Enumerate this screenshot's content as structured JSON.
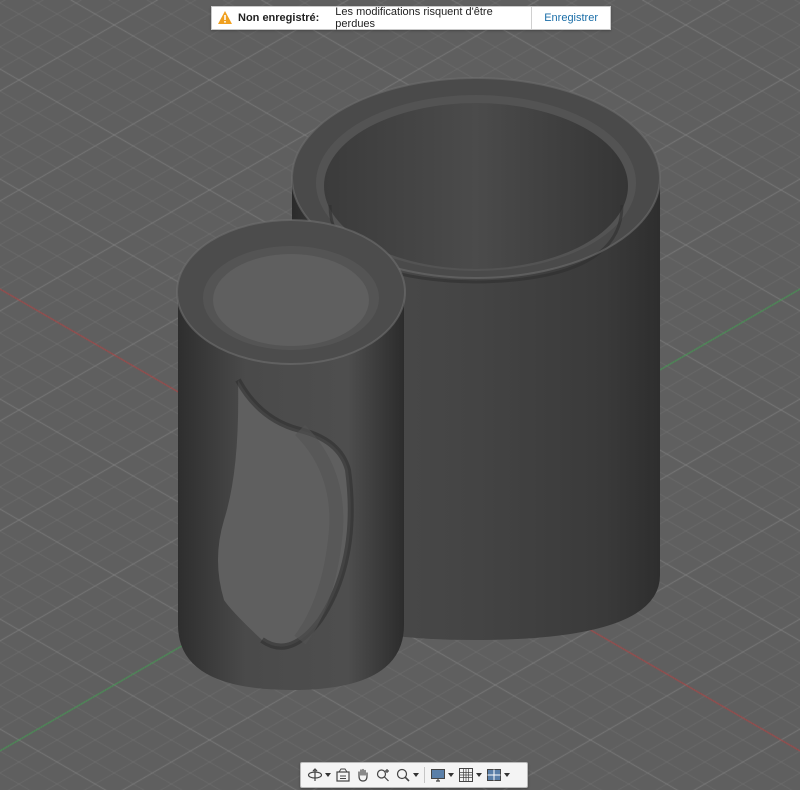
{
  "banner": {
    "title": "Non enregistré:",
    "message": "Les modifications risquent d'être perdues",
    "action": "Enregistrer",
    "warning_icon": "warning-triangle-icon",
    "warning_color": "#f0a020",
    "link_color": "#1b6ea8"
  },
  "viewport": {
    "background_color": "#5f5f5f",
    "grid_color": "#737373",
    "axis_x_color": "#b03a3a",
    "axis_y_color": "#3a9a4a",
    "model_color": "#3c3c3c"
  },
  "toolbar": {
    "items": [
      {
        "name": "orbit",
        "icon": "orbit-icon",
        "has_dropdown": true
      },
      {
        "name": "look-at",
        "icon": "look-at-icon",
        "has_dropdown": false
      },
      {
        "name": "pan",
        "icon": "pan-hand-icon",
        "has_dropdown": false
      },
      {
        "name": "zoom",
        "icon": "zoom-icon",
        "has_dropdown": false
      },
      {
        "name": "fit",
        "icon": "zoom-window-icon",
        "has_dropdown": true
      },
      {
        "name": "display-settings",
        "icon": "display-settings-icon",
        "has_dropdown": true
      },
      {
        "name": "grid-snaps",
        "icon": "grid-icon",
        "has_dropdown": true
      },
      {
        "name": "viewports",
        "icon": "viewports-icon",
        "has_dropdown": true
      }
    ]
  }
}
